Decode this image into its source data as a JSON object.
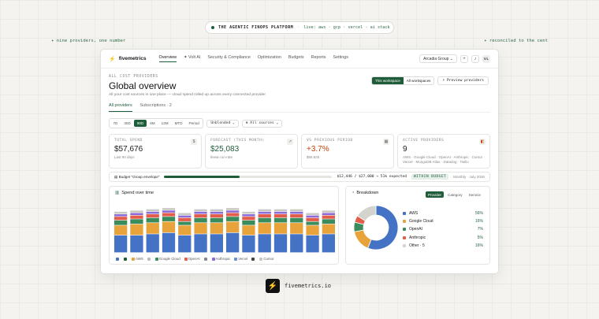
{
  "hero": {
    "badge_title": "THE AGENTIC FINOPS PLATFORM",
    "badge_sep": "·",
    "badge_live": "live: aws · gcp · vercel · ai stack",
    "note_left": "✦ nine providers, one number",
    "note_right": "✦ reconciled to the cent"
  },
  "nav": {
    "brand": "fivemetrics",
    "tabs": [
      "Overview",
      "✦ Volt AI",
      "Security & Compliance",
      "Optimization",
      "Budgets",
      "Reports",
      "Settings"
    ],
    "org": "Arcadia Group ⌄",
    "add": "+",
    "user": "ML"
  },
  "header": {
    "kicker": "ALL COST PROVIDERS",
    "title": "Global overview",
    "subtitle": "All your cost sources in one place — cloud spend rolled up across every connected provider",
    "scope_this": "This workspace",
    "scope_all": "All workspaces",
    "preview": "Preview providers"
  },
  "subtabs": [
    "All providers",
    "Subscriptions · 2"
  ],
  "filters": {
    "ranges": [
      "7D",
      "30D",
      "90D",
      "6M",
      "12M",
      "MTD",
      "Period"
    ],
    "active_range": "90D",
    "mode": "Unblended ⌄",
    "sources": "⊕ All sources ⌄"
  },
  "kpis": [
    {
      "label": "TOTAL SPEND",
      "value": "$57,676",
      "note": "Last 90 days",
      "icon": "$",
      "color": "#1a1a1a"
    },
    {
      "label": "FORECAST (THIS MONTH)",
      "value": "$25,083",
      "note": "linear run-rate",
      "icon": "📈",
      "color": "#1f5c3a"
    },
    {
      "label": "VS PREVIOUS PERIOD",
      "value": "+3.7%",
      "note": "$55,625",
      "icon": "▦",
      "color": "#c2410c"
    },
    {
      "label": "ACTIVE PROVIDERS",
      "value": "9",
      "note": "AWS · Google Cloud · OpenAI · Anthropic · Cursor · Vercel · MongoDB Atlas · Datadog · Twilio",
      "icon": "◧",
      "color": "#1a1a1a"
    }
  ],
  "budget": {
    "label": "▤ Budget \"Group envelope\"",
    "progress": 0.45,
    "amount": "$12,446 / $27,000 → 51k expected",
    "status": "WITHIN BUDGET",
    "period": "Monthly · July 2026"
  },
  "spend": {
    "title": "Spend over time",
    "legend": [
      "",
      "",
      "AWS",
      "",
      "Google Cloud",
      "OpenAI",
      "",
      "Anthropic",
      "Vercel",
      "",
      "Cursor"
    ]
  },
  "chart_data": {
    "type": "bar",
    "stacked": true,
    "title": "Spend over time",
    "categories": [
      "",
      "",
      "",
      "",
      "",
      "",
      "",
      "",
      "",
      "",
      "",
      "",
      "",
      ""
    ],
    "series": [
      {
        "name": "AWS",
        "color": "#4472c4",
        "values": [
          14,
          14,
          15,
          16,
          14,
          15,
          15,
          16,
          14,
          15,
          15,
          15,
          14,
          15
        ]
      },
      {
        "name": "Google Cloud",
        "color": "#e8a33b",
        "values": [
          8,
          9,
          9,
          9,
          8,
          9,
          9,
          9,
          8,
          9,
          9,
          9,
          8,
          8
        ]
      },
      {
        "name": "OpenAI",
        "color": "#3a8c5c",
        "values": [
          4,
          4,
          4,
          4,
          3,
          4,
          4,
          4,
          4,
          4,
          4,
          4,
          3,
          4
        ]
      },
      {
        "name": "Anthropic",
        "color": "#e35d4a",
        "values": [
          3,
          3,
          3,
          3,
          3,
          3,
          3,
          3,
          3,
          3,
          3,
          3,
          3,
          3
        ]
      },
      {
        "name": "Vercel",
        "color": "#8c6bd8",
        "values": [
          2,
          2,
          2,
          2,
          2,
          2,
          2,
          2,
          2,
          2,
          2,
          2,
          2,
          2
        ]
      },
      {
        "name": "Cursor",
        "color": "#c9c9c4",
        "values": [
          2,
          2,
          2,
          2,
          2,
          2,
          2,
          2,
          2,
          2,
          2,
          2,
          2,
          2
        ]
      }
    ]
  },
  "breakdown": {
    "title": "Breakdown",
    "tabs": [
      "Provider",
      "Category",
      "Service"
    ],
    "items": [
      {
        "name": "AWS",
        "pct": "56%",
        "share": 56,
        "color": "#4472c4"
      },
      {
        "name": "Google Cloud",
        "pct": "16%",
        "share": 16,
        "color": "#e8a33b"
      },
      {
        "name": "OpenAI",
        "pct": "7%",
        "share": 7,
        "color": "#3a8c5c"
      },
      {
        "name": "Anthropic",
        "pct": "5%",
        "share": 5,
        "color": "#e35d4a"
      },
      {
        "name": "Other · 5",
        "pct": "16%",
        "share": 16,
        "color": "#d4d4cf"
      }
    ]
  },
  "footer": {
    "url": "fivemetrics.io",
    "logo": "⚡"
  }
}
